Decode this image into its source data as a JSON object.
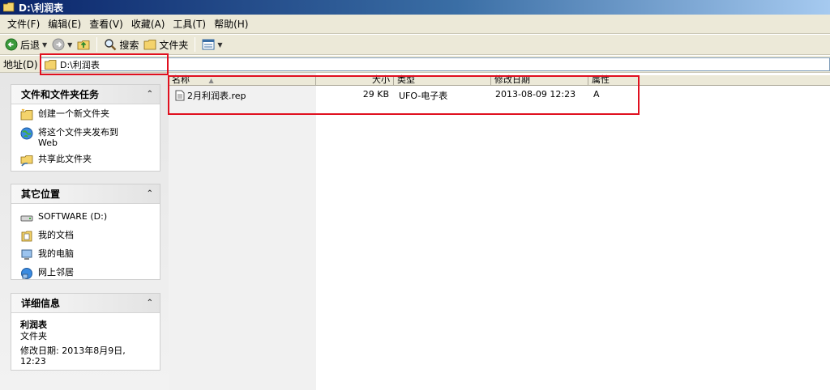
{
  "title": "D:\\利润表",
  "menu": [
    "文件(F)",
    "编辑(E)",
    "查看(V)",
    "收藏(A)",
    "工具(T)",
    "帮助(H)"
  ],
  "toolbar": {
    "back": "后退",
    "search": "搜索",
    "folders": "文件夹"
  },
  "address": {
    "label": "地址(D)",
    "value": "D:\\利润表"
  },
  "tasks": {
    "title": "文件和文件夹任务",
    "items": [
      "创建一个新文件夹",
      "将这个文件夹发布到 Web",
      "共享此文件夹"
    ]
  },
  "places": {
    "title": "其它位置",
    "items": [
      "SOFTWARE (D:)",
      "我的文档",
      "我的电脑",
      "网上邻居"
    ]
  },
  "details": {
    "title": "详细信息",
    "name": "利润表",
    "type": "文件夹",
    "modified": "修改日期: 2013年8月9日, 12:23"
  },
  "columns": {
    "name": "名称",
    "size": "大小",
    "type": "类型",
    "date": "修改日期",
    "attr": "属性"
  },
  "files": [
    {
      "name": "2月利润表.rep",
      "size": "29 KB",
      "type": "UFO-电子表",
      "date": "2013-08-09 12:23",
      "attr": "A"
    }
  ],
  "colors": {
    "title_start": "#0a246a",
    "title_end": "#a6caf0",
    "highlight": "#e0101f"
  },
  "icons": [
    "folder-icon",
    "back-arrow-icon",
    "forward-arrow-icon",
    "up-folder-icon",
    "search-icon",
    "views-icon",
    "file-icon",
    "drive-icon",
    "my-documents-icon",
    "my-computer-icon",
    "network-icon"
  ]
}
